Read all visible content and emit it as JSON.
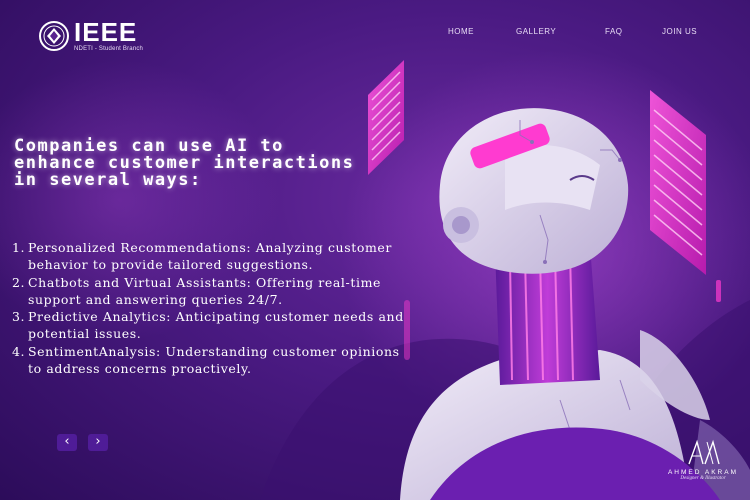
{
  "logo": {
    "title": "IEEE",
    "subtitle": "NDETI - Student Branch",
    "emblem_icon": "ieee-emblem-icon"
  },
  "nav": {
    "items": [
      {
        "label": "HOME"
      },
      {
        "label": "GALLERY"
      },
      {
        "label": "FAQ"
      },
      {
        "label": "JOIN US"
      }
    ]
  },
  "heading": "Companies can use AI to enhance customer interactions in several ways:",
  "ways": [
    {
      "num": "1.",
      "text": "Personalized Recommendations: Analyzing customer behavior to provide tailored suggestions."
    },
    {
      "num": "2.",
      "text": "Chatbots and Virtual Assistants: Offering real-time support and answering queries 24/7."
    },
    {
      "num": "3.",
      "text": "Predictive Analytics: Anticipating customer needs and potential issues."
    },
    {
      "num": "4.",
      "text": "SentimentAnalysis: Understanding customer opinions to address concerns proactively."
    }
  ],
  "controls": {
    "prev_label": "‹",
    "next_label": "›",
    "prev_icon": "chevron-left-icon",
    "next_icon": "chevron-right-icon"
  },
  "signature": {
    "name": "AHMED AKRAM",
    "role": "Designer & Illustrator"
  },
  "colors": {
    "background": "#4a1a82",
    "accent_pink": "#ff3bd0",
    "robot_body": "#d9d2e9",
    "button": "#4f1c97"
  }
}
